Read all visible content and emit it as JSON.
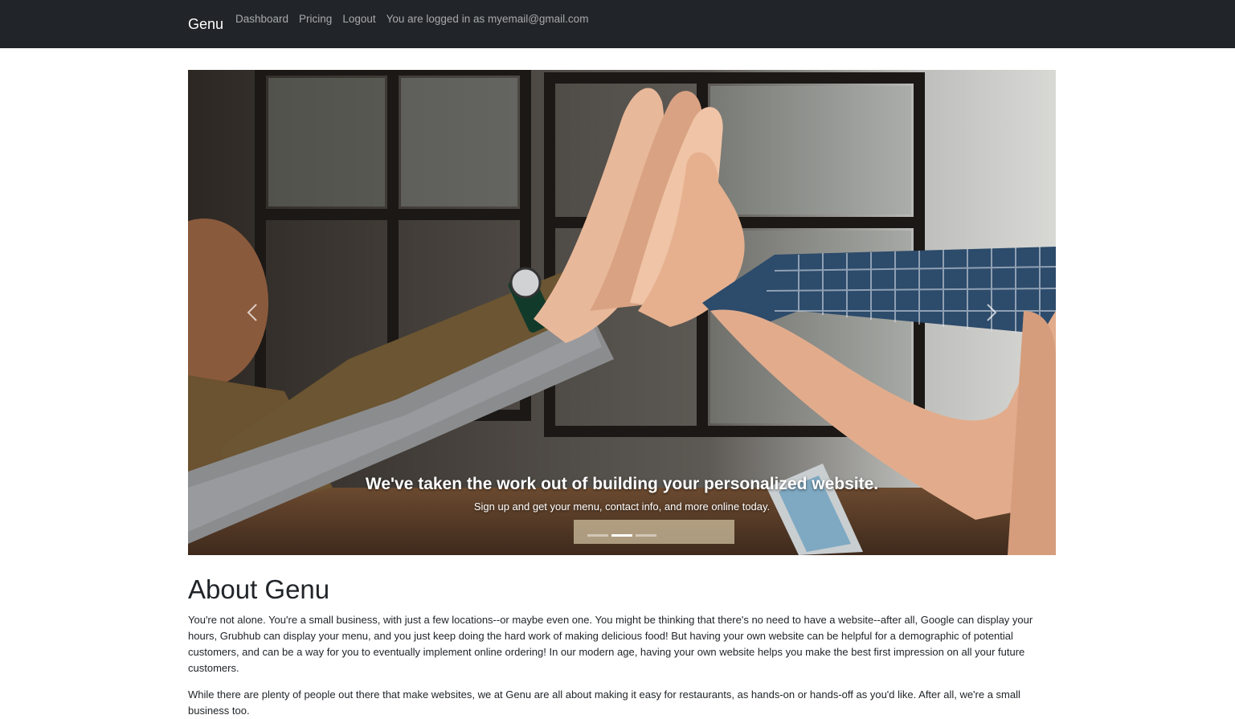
{
  "navbar": {
    "brand": "Genu",
    "links": [
      "Dashboard",
      "Pricing",
      "Logout"
    ],
    "login_status": "You are logged in as myemail@gmail.com"
  },
  "carousel": {
    "caption_title": "We've taken the work out of building your personalized website.",
    "caption_text": "Sign up and get your menu, contact info, and more online today.",
    "prev_icon": "chevron-left-icon",
    "next_icon": "chevron-right-icon",
    "slide_count": 3,
    "active_slide": 2
  },
  "about": {
    "heading": "About Genu",
    "paragraph1": "You're not alone. You're a small business, with just a few locations--or maybe even one. You might be thinking that there's no need to have a website--after all, Google can display your hours, Grubhub can display your menu, and you just keep doing the hard work of making delicious food! But having your own website can be helpful for a demographic of potential customers, and can be a way for you to eventually implement online ordering! In our modern age, having your own website helps you make the best first impression on all your future customers.",
    "paragraph2": "While there are plenty of people out there that make websites, we at Genu are all about making it easy for restaurants, as hands-on or hands-off as you'd like. After all, we're a small business too."
  },
  "colors": {
    "navbar_bg": "#212529",
    "text": "#212529"
  }
}
